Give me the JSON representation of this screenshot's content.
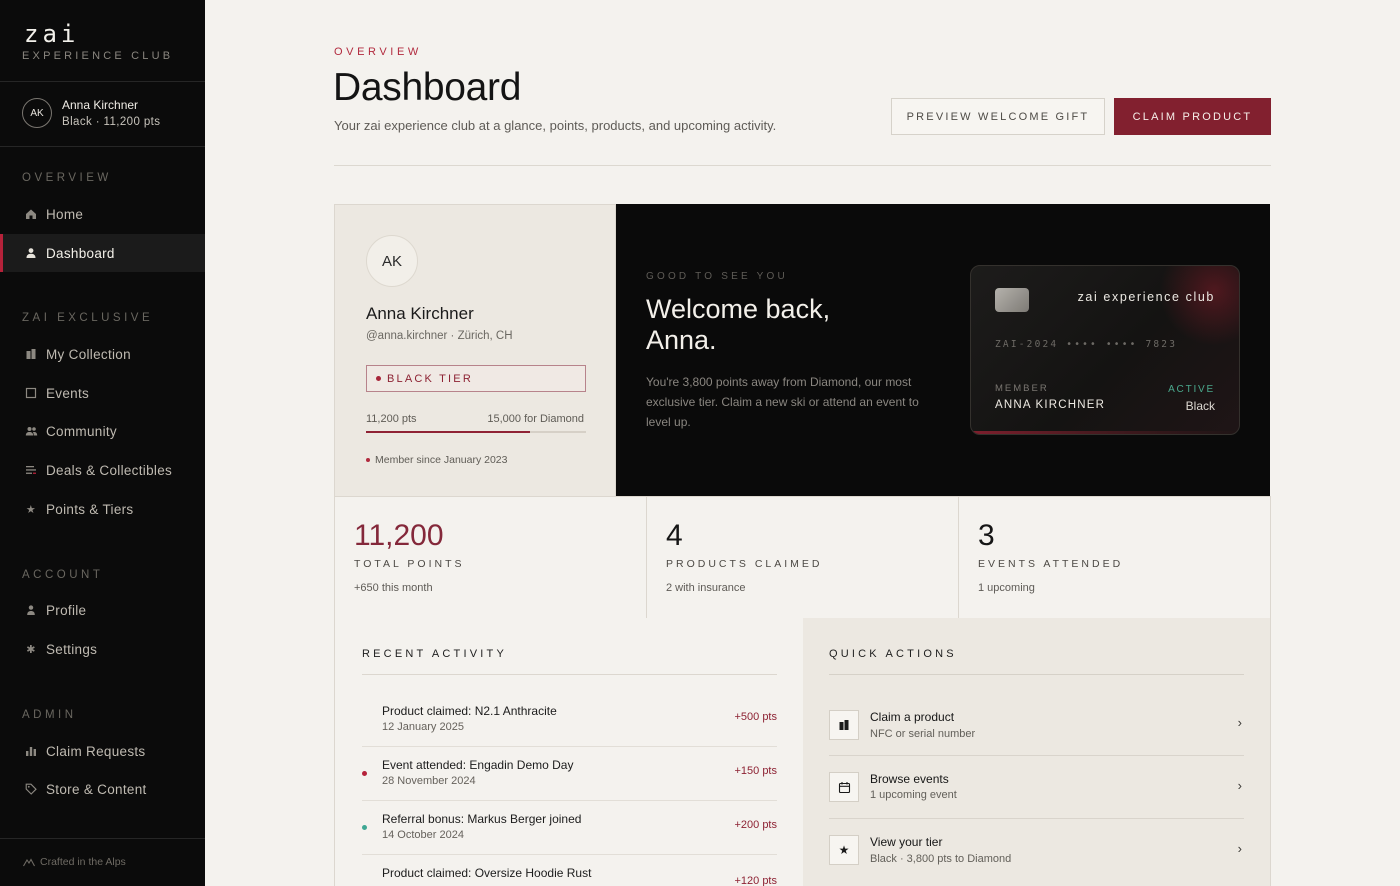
{
  "sidebar": {
    "brand": {
      "logo": "zai",
      "subtitle": "EXPERIENCE CLUB"
    },
    "user": {
      "initials": "AK",
      "name": "Anna Kirchner",
      "tier_points": "Black · 11,200 pts"
    },
    "sections": {
      "overview": "OVERVIEW",
      "exclusive": "ZAI EXCLUSIVE",
      "account": "ACCOUNT",
      "admin": "ADMIN"
    },
    "items": [
      {
        "label": "Home",
        "icon": "home-icon",
        "active": false
      },
      {
        "label": "Dashboard",
        "icon": "user-icon",
        "active": true
      },
      {
        "label": "My Collection",
        "icon": "collection-icon",
        "active": false
      },
      {
        "label": "Events",
        "icon": "square-icon",
        "active": false
      },
      {
        "label": "Community",
        "icon": "people-icon",
        "active": false
      },
      {
        "label": "Deals & Collectibles",
        "icon": "list-icon",
        "active": false
      },
      {
        "label": "Points & Tiers",
        "icon": "star-icon",
        "active": false
      },
      {
        "label": "Profile",
        "icon": "user-icon",
        "active": false
      },
      {
        "label": "Settings",
        "icon": "gear-icon",
        "active": false
      },
      {
        "label": "Claim Requests",
        "icon": "bar-chart-icon",
        "active": false
      },
      {
        "label": "Store & Content",
        "icon": "tag-icon",
        "active": false
      }
    ],
    "footer": "Crafted in the Alps"
  },
  "header": {
    "eyebrow": "OVERVIEW",
    "title": "Dashboard",
    "subtitle": "Your zai experience club at a glance, points, products, and upcoming activity.",
    "preview_button": "PREVIEW WELCOME GIFT",
    "claim_button": "CLAIM PRODUCT"
  },
  "profile": {
    "initials": "AK",
    "name": "Anna Kirchner",
    "handle": "@anna.kirchner · Zürich, CH",
    "tier_badge": "BLACK TIER",
    "points_current": "11,200 pts",
    "points_target": "15,000 for Diamond",
    "progress_fraction": 0.747,
    "member_since": "Member since January 2023"
  },
  "welcome": {
    "eyebrow": "GOOD TO SEE YOU",
    "title_line1": "Welcome back,",
    "title_line2": "Anna.",
    "body": "You're 3,800 points away from Diamond, our most exclusive tier. Claim a new ski or attend an event to level up.",
    "card": {
      "brand": "zai experience club",
      "number": "ZAI-2024 •••• •••• 7823",
      "member_label": "MEMBER",
      "member_name": "ANNA KIRCHNER",
      "status": "ACTIVE",
      "tier": "Black"
    }
  },
  "stats": [
    {
      "value": "11,200",
      "label": "TOTAL POINTS",
      "sub": "+650 this month"
    },
    {
      "value": "4",
      "label": "PRODUCTS CLAIMED",
      "sub": "2 with insurance"
    },
    {
      "value": "3",
      "label": "EVENTS ATTENDED",
      "sub": "1 upcoming"
    }
  ],
  "activity": {
    "title": "RECENT ACTIVITY",
    "items": [
      {
        "title": "Product claimed: N2.1 Anthracite",
        "date": "12 January 2025",
        "points": "+500 pts",
        "dot_color": ""
      },
      {
        "title": "Event attended: Engadin Demo Day",
        "date": "28 November 2024",
        "points": "+150 pts",
        "dot_color": "#b5223a"
      },
      {
        "title": "Referral bonus: Markus Berger joined",
        "date": "14 October 2024",
        "points": "+200 pts",
        "dot_color": "#3fa793"
      },
      {
        "title": "Product claimed: Oversize Hoodie Rust",
        "date": "",
        "points": "+120 pts",
        "dot_color": ""
      }
    ]
  },
  "quick_actions": {
    "title": "QUICK ACTIONS",
    "items": [
      {
        "title": "Claim a product",
        "sub": "NFC or serial number",
        "icon": "collection-icon"
      },
      {
        "title": "Browse events",
        "sub": "1 upcoming event",
        "icon": "calendar-icon"
      },
      {
        "title": "View your tier",
        "sub": "Black · 3,800 pts to Diamond",
        "icon": "star-icon"
      }
    ]
  },
  "colors": {
    "accent": "#82202f",
    "accent_text": "#b22b3f",
    "active_green": "#4aa88c",
    "sidebar_bg": "#0b0b0b"
  }
}
